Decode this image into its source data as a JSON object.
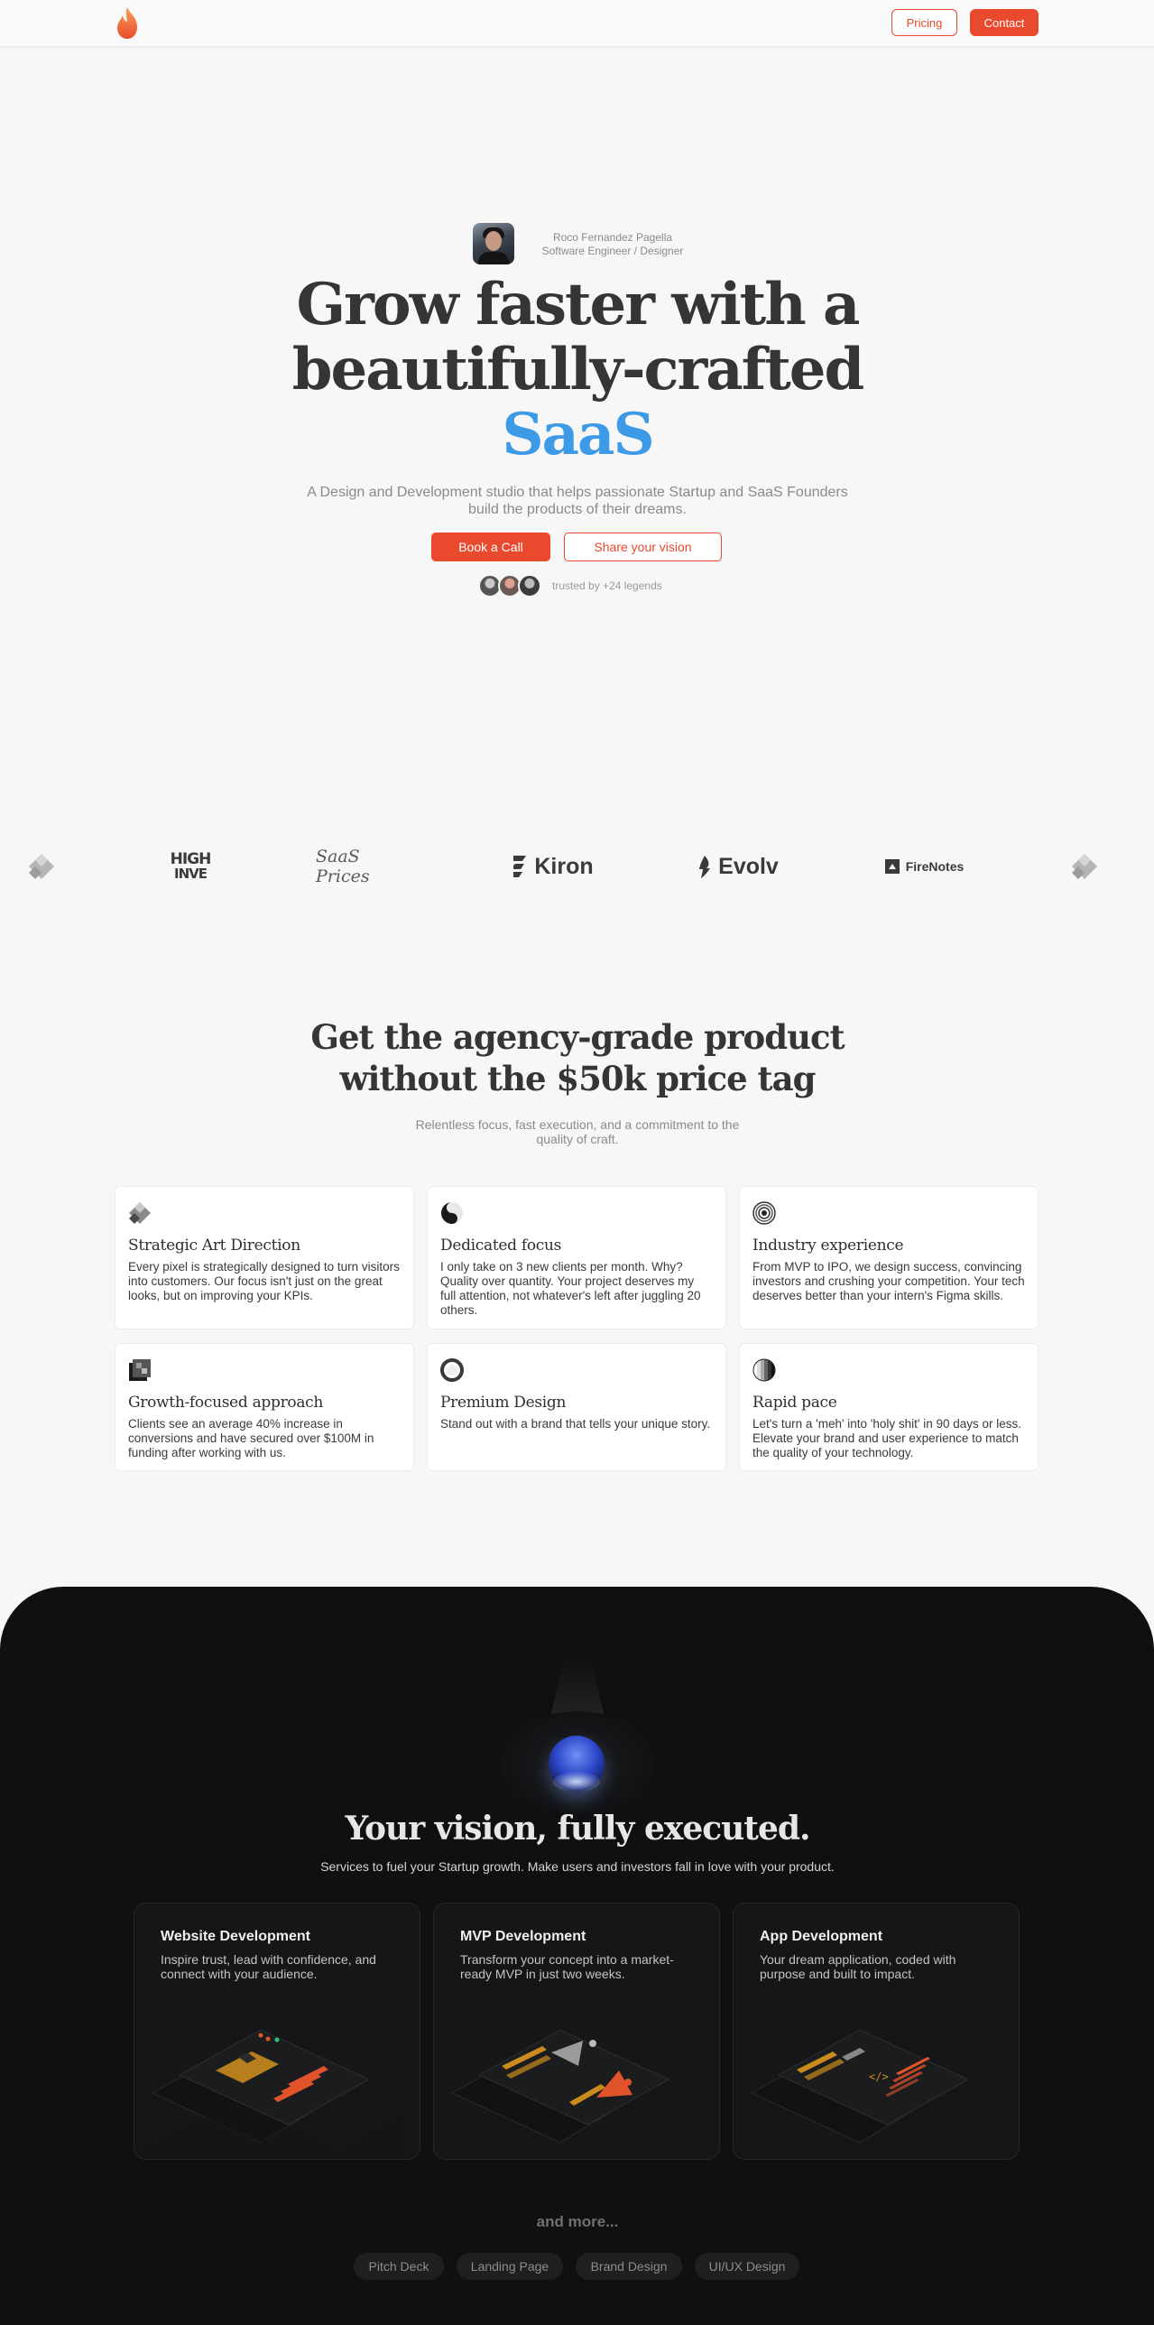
{
  "nav": {
    "pricing_label": "Pricing",
    "contact_label": "Contact"
  },
  "hero": {
    "author_name": "Roco Fernandez Pagella",
    "author_role": "Software Engineer / Designer",
    "title_line1": "Grow faster with a",
    "title_line2": "beautifully-crafted",
    "title_accent": "SaaS",
    "subtitle": "A Design and Development studio that helps passionate Startup and SaaS Founders build the products of their dreams.",
    "book_label": "Book a Call",
    "share_label": "Share your vision",
    "trusted_text": "trusted by +24 legends"
  },
  "logos": {
    "high_line1": "HIGH",
    "high_line2": "INVE",
    "saas_prices": "SaaS Prices",
    "kiron": "Kiron",
    "evolv": "Evolv",
    "firenotes": "FireNotes"
  },
  "section2": {
    "title_line1": "Get the agency-grade product",
    "title_line2": "without the $50k price tag",
    "subtitle": "Relentless focus, fast execution, and a commitment to the quality of craft."
  },
  "features": [
    {
      "title": "Strategic Art Direction",
      "text": "Every pixel is strategically designed to turn visitors into customers. Our focus isn't just on the great looks, but on improving your KPIs."
    },
    {
      "title": "Dedicated focus",
      "text": "I only take on 3 new clients per month. Why? Quality over quantity. Your project deserves my full attention, not whatever's left after juggling 20 others."
    },
    {
      "title": "Industry experience",
      "text": "From MVP to IPO, we design success, convincing investors and crushing your competition. Your tech deserves better than your intern's Figma skills."
    },
    {
      "title": "Growth-focused approach",
      "text": "Clients see an average 40% increase in conversions and have secured over $100M in funding after working with us."
    },
    {
      "title": "Premium Design",
      "text": "Stand out with a brand that tells your unique story."
    },
    {
      "title": "Rapid pace",
      "text": "Let's turn a 'meh' into 'holy shit' in 90 days or less. Elevate your brand and user experience to match the quality of your technology."
    }
  ],
  "services": {
    "title": "Your vision, fully executed.",
    "subtitle": "Services to fuel your Startup growth. Make users and investors fall in love with your product.",
    "items": [
      {
        "title": "Website Development",
        "text": "Inspire trust, lead with confidence, and connect with your audience."
      },
      {
        "title": "MVP Development",
        "text": "Transform your concept into a market-ready MVP in just two weeks."
      },
      {
        "title": "App Development",
        "text": "Your dream application, coded with purpose and built to impact."
      }
    ],
    "and_more": "and more...",
    "pills": [
      "Pitch Deck",
      "Landing Page",
      "Brand Design",
      "UI/UX Design"
    ]
  },
  "colors": {
    "accent": "#e9492c",
    "highlight": "#3c9ae6",
    "dark_bg": "#0f1011"
  }
}
